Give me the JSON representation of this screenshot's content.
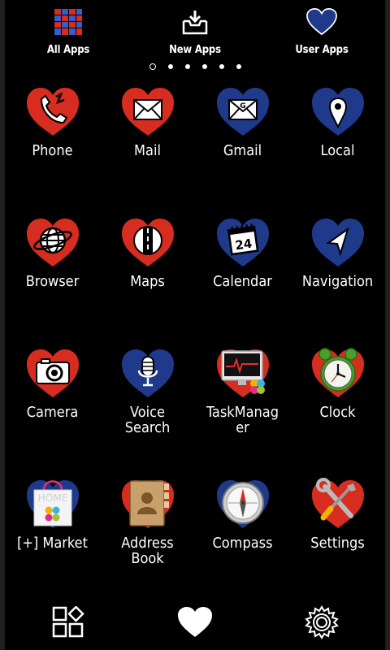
{
  "top_tabs": [
    {
      "label": "All Apps",
      "icon": "grid-squares-icon"
    },
    {
      "label": "New Apps",
      "icon": "download-box-icon"
    },
    {
      "label": "User Apps",
      "icon": "heart-icon"
    }
  ],
  "page_indicator": {
    "count": 6,
    "active": 1
  },
  "apps": [
    {
      "label": "Phone",
      "icon": "phone-icon",
      "heart_color": "#d62d20"
    },
    {
      "label": "Mail",
      "icon": "envelope-icon",
      "heart_color": "#d62d20"
    },
    {
      "label": "Gmail",
      "icon": "gmail-envelope-icon",
      "heart_color": "#1f3a8a"
    },
    {
      "label": "Local",
      "icon": "location-pin-icon",
      "heart_color": "#1f3a8a"
    },
    {
      "label": "Browser",
      "icon": "globe-icon",
      "heart_color": "#d62d20"
    },
    {
      "label": "Maps",
      "icon": "road-icon",
      "heart_color": "#d62d20"
    },
    {
      "label": "Calendar",
      "icon": "calendar-icon",
      "heart_color": "#1f3a8a",
      "calendar_day": "24"
    },
    {
      "label": "Navigation",
      "icon": "navigation-arrow-icon",
      "heart_color": "#1f3a8a"
    },
    {
      "label": "Camera",
      "icon": "camera-icon",
      "heart_color": "#d62d20"
    },
    {
      "label": "Voice\nSearch",
      "icon": "microphone-icon",
      "heart_color": "#1f3a8a"
    },
    {
      "label": "TaskManag\ner",
      "icon": "monitor-icon",
      "heart_color": "#d62d20"
    },
    {
      "label": "Clock",
      "icon": "alarm-clock-icon",
      "heart_color": "#d62d20"
    },
    {
      "label": "[+] Market",
      "icon": "shopping-bag-icon",
      "heart_color": "#1f3a8a",
      "bag_text": "HOME"
    },
    {
      "label": "Address\nBook",
      "icon": "address-book-icon",
      "heart_color": "#d62d20"
    },
    {
      "label": "Compass",
      "icon": "compass-icon",
      "heart_color": "#1f3a8a"
    },
    {
      "label": "Settings",
      "icon": "tools-icon",
      "heart_color": "#d62d20"
    }
  ],
  "dock": [
    {
      "icon": "widgets-icon"
    },
    {
      "icon": "heart-icon"
    },
    {
      "icon": "gear-icon"
    }
  ],
  "colors": {
    "red": "#d62d20",
    "navy": "#1f3a8a",
    "background": "#000000",
    "text": "#ffffff"
  }
}
